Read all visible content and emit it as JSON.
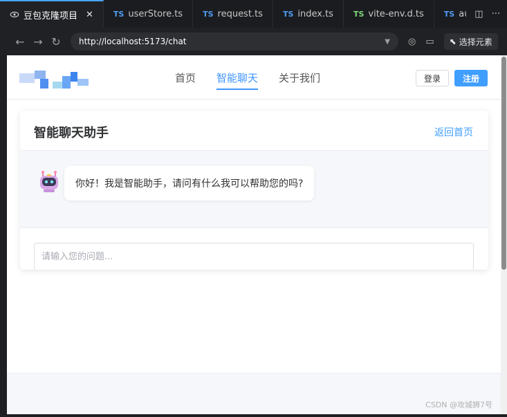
{
  "browser": {
    "tabs": [
      {
        "label": "豆包克隆项目",
        "kind": "preview",
        "active": true
      },
      {
        "label": "userStore.ts",
        "kind": "TS"
      },
      {
        "label": "request.ts",
        "kind": "TS"
      },
      {
        "label": "index.ts",
        "kind": "TS"
      },
      {
        "label": "vite-env.d.ts",
        "kind": "TS"
      },
      {
        "label": "auth.t",
        "kind": "TS"
      }
    ],
    "tab_close": "✕",
    "tab_actions": {
      "split": "◫",
      "more": "···"
    },
    "url": "http://localhost:5173/chat",
    "pick_element": "选择元素",
    "accent_color": "#4aa3ff"
  },
  "site": {
    "nav": [
      {
        "label": "首页",
        "active": false
      },
      {
        "label": "智能聊天",
        "active": true
      },
      {
        "label": "关于我们",
        "active": false
      }
    ],
    "login": "登录",
    "register": "注册",
    "brand_color": "#409eff"
  },
  "chat": {
    "title": "智能聊天助手",
    "back_link": "返回首页",
    "greeting": "你好！我是智能助手，请问有什么我可以帮助您的吗?",
    "input_placeholder": "请输入您的问题..."
  },
  "watermark": "CSDN @攻城狮7号"
}
